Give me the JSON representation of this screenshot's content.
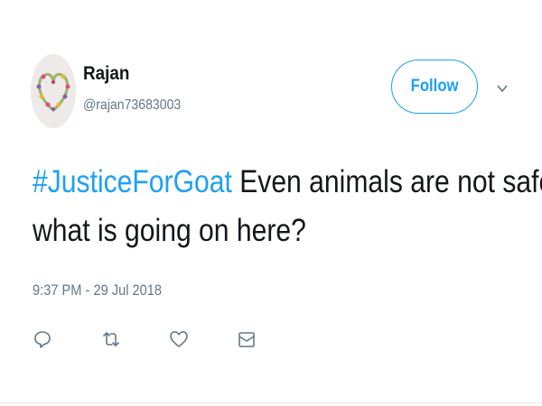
{
  "user": {
    "name": "Rajan",
    "handle": "@rajan73683003"
  },
  "follow_button": {
    "label": "Follow"
  },
  "tweet": {
    "hashtag": "#JusticeForGoat",
    "text_line1": " Even animals are not safe",
    "text_line2": "what is going on here?",
    "timestamp": "9:37 PM - 29 Jul 2018"
  },
  "actions": [
    {
      "icon": "reply-icon"
    },
    {
      "icon": "retweet-icon"
    },
    {
      "icon": "like-icon"
    },
    {
      "icon": "direct-message-icon"
    }
  ],
  "icons": {
    "menu": "chevron-down-icon",
    "avatar": "flower-wreath-avatar"
  },
  "colors": {
    "accent": "#1da1f2",
    "text": "#14171a",
    "muted": "#657786"
  }
}
